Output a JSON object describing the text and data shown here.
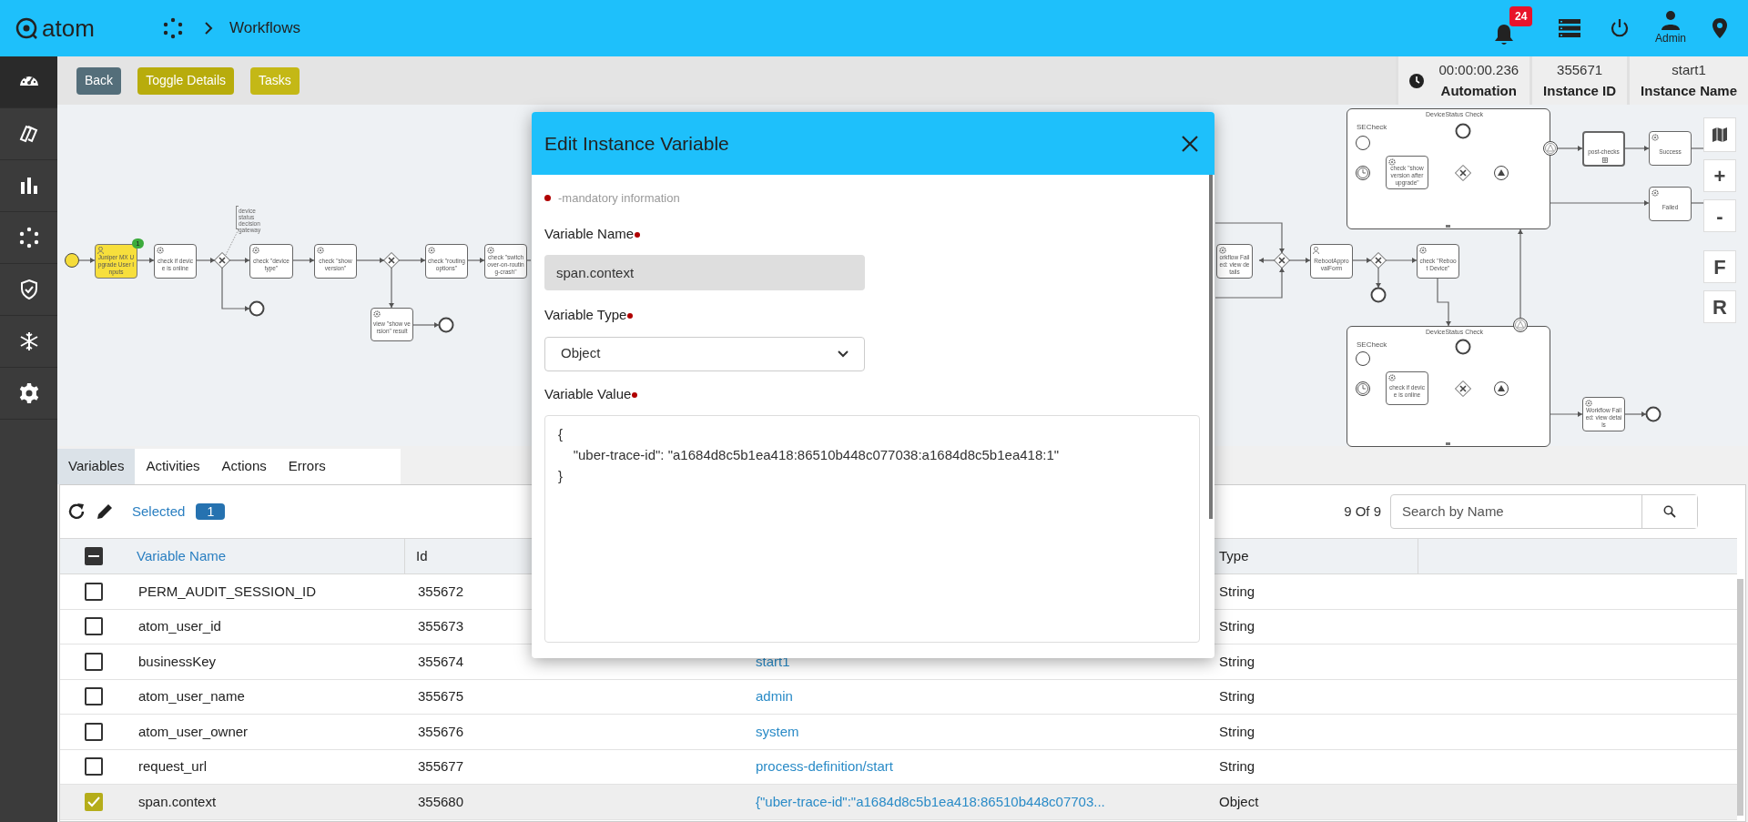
{
  "header": {
    "logo": "atom",
    "breadcrumb": "Workflows",
    "notification_count": "24",
    "user": "Admin"
  },
  "sidebar": {
    "items": [
      {
        "kind": "gauge",
        "selected": true
      },
      {
        "kind": "cards",
        "selected": false
      },
      {
        "kind": "chart",
        "selected": false
      },
      {
        "kind": "workflow",
        "selected": false
      },
      {
        "kind": "shield",
        "selected": false
      },
      {
        "kind": "snowflake",
        "selected": false
      },
      {
        "kind": "gear",
        "selected": false
      }
    ]
  },
  "toolbar": {
    "buttons": [
      {
        "label": "Back",
        "kind": "neutral"
      },
      {
        "label": "Toggle Details",
        "kind": "accent"
      },
      {
        "label": "Tasks",
        "kind": "accent"
      }
    ]
  },
  "instance_info": [
    {
      "value": "00:00:00.236",
      "label": "Automation"
    },
    {
      "value": "355671",
      "label": "Instance ID"
    },
    {
      "value": "start1",
      "label": "Instance Name"
    }
  ],
  "diagram": {
    "tasks": [
      {
        "label": "Juniper MX Upgrade User Inputs",
        "kind": "user",
        "active": true,
        "badge": "1"
      },
      {
        "label": "check if device is online",
        "kind": "service",
        "active": false
      },
      {
        "label": "check \"device type\"",
        "kind": "service",
        "active": false
      },
      {
        "label": "check \"show version\"",
        "kind": "service",
        "active": false
      },
      {
        "label": "check \"routing options\"",
        "kind": "service",
        "active": false
      },
      {
        "label": "check \"switchover-on-routing-crash\"",
        "kind": "service",
        "active": false
      },
      {
        "label": "view \"show version\" result",
        "kind": "service",
        "active": false
      },
      {
        "label": "orkflow Failed: view details",
        "kind": "service",
        "active": false
      },
      {
        "label": "RebootApprovalForm",
        "kind": "user",
        "active": false
      },
      {
        "label": "check \"Reboot Device\"",
        "kind": "service",
        "active": false
      },
      {
        "label": "post-checks",
        "kind": "subprocess",
        "active": false
      },
      {
        "label": "Success",
        "kind": "service",
        "active": false
      },
      {
        "label": "Failed",
        "kind": "service",
        "active": false
      },
      {
        "label": "Workflow Failed: view details",
        "kind": "service",
        "active": false
      }
    ],
    "annotation": "device status decision gateway",
    "subprocesses": [
      {
        "title": "DeviceStatus Check",
        "label": "SECheck",
        "task": "check \"show version after upgrade\""
      },
      {
        "title": "DeviceStatus Check",
        "label": "SECheck",
        "task": "check if device is online"
      }
    ],
    "controls": [
      "+",
      "-",
      "F",
      "R"
    ]
  },
  "tabs": [
    {
      "label": "Variables",
      "selected": true
    },
    {
      "label": "Activities",
      "selected": false
    },
    {
      "label": "Actions",
      "selected": false
    },
    {
      "label": "Errors",
      "selected": false
    }
  ],
  "table": {
    "selected_label": "Selected",
    "selected_count": "1",
    "count": "9 Of 9",
    "search": {
      "placeholder": "Search by Name"
    },
    "header_checkbox": {
      "indeterminate": true
    },
    "columns": [
      "Variable Name",
      "Id",
      "Type"
    ],
    "rows": [
      {
        "name": "PERM_AUDIT_SESSION_ID",
        "id": "355672",
        "type": "String",
        "selected": false
      },
      {
        "name": "atom_user_id",
        "id": "355673",
        "type": "String",
        "selected": false
      },
      {
        "name": "businessKey",
        "id": "355674",
        "column_3": "start1",
        "type": "String",
        "selected": false
      },
      {
        "name": "atom_user_name",
        "id": "355675",
        "column_3": "admin",
        "type": "String",
        "selected": false
      },
      {
        "name": "atom_user_owner",
        "id": "355676",
        "column_3": "system",
        "type": "String",
        "selected": false
      },
      {
        "name": "request_url",
        "id": "355677",
        "column_3": "process-definition/start",
        "type": "String",
        "selected": false
      },
      {
        "name": "span.context",
        "id": "355680",
        "column_3": "{\"uber-trace-id\":\"a1684d8c5b1ea418:86510b448c07703...",
        "type": "Object",
        "selected": true
      }
    ]
  },
  "modal": {
    "title": "Edit Instance Variable",
    "note": "-mandatory information",
    "fields": [
      {
        "label": "Variable Name",
        "kind": "text",
        "value": "span.context",
        "required": true,
        "disabled": true
      },
      {
        "label": "Variable Type",
        "kind": "select",
        "value": "Object",
        "required": true,
        "disabled": false
      },
      {
        "label": "Variable Value",
        "kind": "textarea",
        "value": "{\n    \"uber-trace-id\": \"a1684d8c5b1ea418:86510b448c077038:a1684d8c5b1ea418:1\"\n}",
        "required": true,
        "disabled": false
      }
    ]
  }
}
